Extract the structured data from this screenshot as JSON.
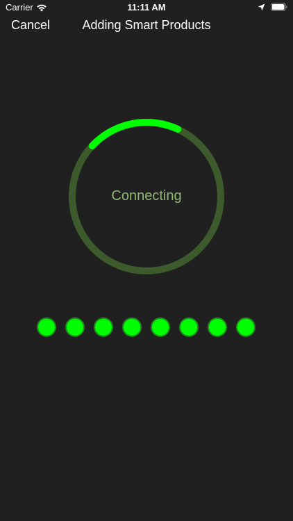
{
  "status_bar": {
    "carrier": "Carrier",
    "time": "11:11 AM",
    "icons": [
      "wifi-icon",
      "location-arrow-icon",
      "battery-icon"
    ]
  },
  "nav_bar": {
    "cancel_label": "Cancel",
    "title": "Adding Smart Products"
  },
  "progress": {
    "label": "Connecting",
    "fraction": 0.2,
    "track_color": "#3d5a2c",
    "fill_color": "#00ff00",
    "label_color": "#8fb872"
  },
  "dots": {
    "count": 8,
    "color": "#00ff00",
    "border_color": "#1e8a1e"
  },
  "colors": {
    "background": "#202020",
    "text": "#ffffff"
  }
}
